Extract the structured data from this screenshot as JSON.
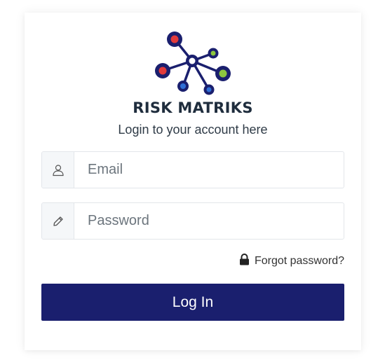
{
  "brand": {
    "name": "RISK MATRIKS",
    "subtitle": "Login to your account here"
  },
  "form": {
    "email": {
      "placeholder": "Email",
      "value": "",
      "icon": "user-icon"
    },
    "password": {
      "placeholder": "Password",
      "value": "",
      "icon": "pencil-icon"
    },
    "forgot_label": "Forgot password?",
    "forgot_icon": "lock-icon",
    "login_label": "Log In"
  },
  "colors": {
    "primary": "#1a1f6e",
    "brand_text": "#1f2d3d",
    "node_red": "#e23b3b",
    "node_green": "#8cc63f",
    "node_blue": "#2f6fd6",
    "node_ring": "#1a1f6e"
  }
}
